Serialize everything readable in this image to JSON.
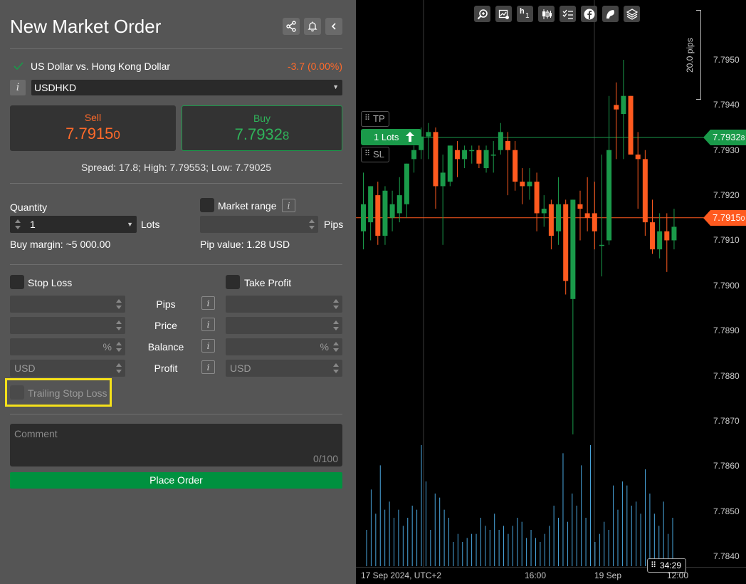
{
  "order": {
    "title": "New Market Order",
    "instrument_name": "US Dollar vs. Hong Kong Dollar",
    "change": "-3.7 (0.00%)",
    "symbol": "USDHKD",
    "sell_label": "Sell",
    "sell_price_main": "7.7915",
    "sell_price_pip": "0",
    "buy_label": "Buy",
    "buy_price_main": "7.7932",
    "buy_price_pip": "8",
    "stats": "Spread: 17.8; High: 7.79553; Low: 7.79025",
    "quantity_label": "Quantity",
    "quantity_value": "1",
    "quantity_unit": "Lots",
    "market_range_label": "Market range",
    "pips_unit": "Pips",
    "buy_margin": "Buy margin: ~5 000.00",
    "pip_value": "Pip value: 1.28 USD",
    "stop_loss_label": "Stop Loss",
    "take_profit_label": "Take Profit",
    "row_labels": [
      "Pips",
      "Price",
      "Balance",
      "Profit"
    ],
    "percent_suffix": "%",
    "currency_placeholder": "USD",
    "trailing_stop_label": "Trailing Stop Loss",
    "comment_placeholder": "Comment",
    "comment_count": "0/100",
    "place_order_label": "Place Order",
    "info_glyph": "i"
  },
  "chart": {
    "colors": {
      "bull": "#1a9a4a",
      "bear": "#ff5a1f",
      "volume": "#4aa8e0",
      "buy_line": "#1a9a4a",
      "sell_line": "#ff5a1f"
    },
    "toolbar_icons": [
      "zoom-icon",
      "settings-chart-icon",
      "timeframe-h1-icon",
      "candles-icon",
      "indicators-icon",
      "facebook-icon",
      "drawings-icon",
      "layers-icon"
    ],
    "timeframe_label": "h",
    "timeframe_sub": "1",
    "price_labels": [
      "7.7950",
      "7.7940",
      "7.7930",
      "7.7920",
      "7.7910",
      "7.7900",
      "7.7890",
      "7.7880",
      "7.7870",
      "7.7860",
      "7.7850",
      "7.7840"
    ],
    "buy_tag_main": "7.7932",
    "buy_tag_pip": "8",
    "sell_tag_main": "7.7915",
    "sell_tag_pip": "0",
    "pips_scale_label": "20.0 pips",
    "tp_label": "TP",
    "sl_label": "SL",
    "lots_label": "1 Lots",
    "time_labels": [
      "17 Sep 2024, UTC+2",
      "16:00",
      "19 Sep",
      "12:00"
    ],
    "countdown": "34:29"
  },
  "chart_data": {
    "type": "candlestick",
    "symbol": "USDHKD",
    "ylim": [
      7.7837,
      7.7962
    ],
    "bid": 7.7915,
    "ask": 7.79328,
    "candles": [
      {
        "o": 7.7912,
        "h": 7.7925,
        "l": 7.7908,
        "c": 7.7918
      },
      {
        "o": 7.7914,
        "h": 7.7922,
        "l": 7.791,
        "c": 7.7922
      },
      {
        "o": 7.792,
        "h": 7.7923,
        "l": 7.7909,
        "c": 7.7911
      },
      {
        "o": 7.7911,
        "h": 7.7922,
        "l": 7.7909,
        "c": 7.7921
      },
      {
        "o": 7.7915,
        "h": 7.7921,
        "l": 7.7912,
        "c": 7.7918
      },
      {
        "o": 7.7916,
        "h": 7.7924,
        "l": 7.7914,
        "c": 7.792
      },
      {
        "o": 7.7918,
        "h": 7.7927,
        "l": 7.7915,
        "c": 7.7927
      },
      {
        "o": 7.7928,
        "h": 7.7931,
        "l": 7.7925,
        "c": 7.793
      },
      {
        "o": 7.793,
        "h": 7.7935,
        "l": 7.7928,
        "c": 7.7933
      },
      {
        "o": 7.7933,
        "h": 7.7936,
        "l": 7.7928,
        "c": 7.7934
      },
      {
        "o": 7.7934,
        "h": 7.7935,
        "l": 7.7917,
        "c": 7.7922
      },
      {
        "o": 7.7922,
        "h": 7.7929,
        "l": 7.7909,
        "c": 7.7925
      },
      {
        "o": 7.7923,
        "h": 7.7931,
        "l": 7.7922,
        "c": 7.7931
      },
      {
        "o": 7.793,
        "h": 7.7932,
        "l": 7.7924,
        "c": 7.7928
      },
      {
        "o": 7.7928,
        "h": 7.7931,
        "l": 7.7926,
        "c": 7.793
      },
      {
        "o": 7.793,
        "h": 7.7931,
        "l": 7.7927,
        "c": 7.793
      },
      {
        "o": 7.793,
        "h": 7.7931,
        "l": 7.7926,
        "c": 7.7927
      },
      {
        "o": 7.7926,
        "h": 7.7931,
        "l": 7.7925,
        "c": 7.793
      },
      {
        "o": 7.7929,
        "h": 7.7932,
        "l": 7.7925,
        "c": 7.7929
      },
      {
        "o": 7.793,
        "h": 7.7936,
        "l": 7.7929,
        "c": 7.7934
      },
      {
        "o": 7.7932,
        "h": 7.7934,
        "l": 7.792,
        "c": 7.793
      },
      {
        "o": 7.793,
        "h": 7.7932,
        "l": 7.7921,
        "c": 7.7923
      },
      {
        "o": 7.7923,
        "h": 7.7926,
        "l": 7.7918,
        "c": 7.7922
      },
      {
        "o": 7.7922,
        "h": 7.7926,
        "l": 7.7919,
        "c": 7.7923
      },
      {
        "o": 7.7923,
        "h": 7.7925,
        "l": 7.7912,
        "c": 7.7916
      },
      {
        "o": 7.7916,
        "h": 7.792,
        "l": 7.7913,
        "c": 7.7917
      },
      {
        "o": 7.7918,
        "h": 7.7919,
        "l": 7.7908,
        "c": 7.7911
      },
      {
        "o": 7.7912,
        "h": 7.7924,
        "l": 7.7909,
        "c": 7.7918
      },
      {
        "o": 7.7918,
        "h": 7.7919,
        "l": 7.7898,
        "c": 7.7901
      },
      {
        "o": 7.7897,
        "h": 7.7919,
        "l": 7.7867,
        "c": 7.7919
      },
      {
        "o": 7.7918,
        "h": 7.7921,
        "l": 7.791,
        "c": 7.7917
      },
      {
        "o": 7.7916,
        "h": 7.7924,
        "l": 7.7912,
        "c": 7.7915
      },
      {
        "o": 7.7916,
        "h": 7.7923,
        "l": 7.7908,
        "c": 7.7912
      },
      {
        "o": 7.7909,
        "h": 7.7929,
        "l": 7.7902,
        "c": 7.7909
      },
      {
        "o": 7.791,
        "h": 7.7942,
        "l": 7.7909,
        "c": 7.793
      },
      {
        "o": 7.794,
        "h": 7.7945,
        "l": 7.7928,
        "c": 7.7939
      },
      {
        "o": 7.7938,
        "h": 7.795,
        "l": 7.7928,
        "c": 7.7942
      },
      {
        "o": 7.7942,
        "h": 7.7942,
        "l": 7.7929,
        "c": 7.7929
      },
      {
        "o": 7.7929,
        "h": 7.7934,
        "l": 7.7917,
        "c": 7.7928
      },
      {
        "o": 7.7928,
        "h": 7.793,
        "l": 7.7911,
        "c": 7.7914
      },
      {
        "o": 7.7914,
        "h": 7.7919,
        "l": 7.7907,
        "c": 7.7908
      },
      {
        "o": 7.7908,
        "h": 7.7916,
        "l": 7.7906,
        "c": 7.7912
      },
      {
        "o": 7.7912,
        "h": 7.7916,
        "l": 7.7903,
        "c": 7.791
      },
      {
        "o": 7.791,
        "h": 7.7917,
        "l": 7.7908,
        "c": 7.7913
      }
    ],
    "volume": [
      9,
      19,
      13,
      25,
      14,
      16,
      12,
      14,
      10,
      12,
      15,
      14,
      30,
      21,
      9,
      18,
      17,
      14,
      12,
      6,
      8,
      6,
      7,
      8,
      8,
      12,
      10,
      9,
      13,
      9,
      10,
      8,
      10,
      12,
      11,
      7,
      9,
      7,
      6,
      8,
      10,
      15,
      12,
      28,
      11,
      18,
      15,
      25,
      12,
      30,
      6,
      8,
      11,
      9,
      20,
      14,
      21,
      20,
      15,
      16,
      13,
      24,
      18,
      13,
      10,
      16,
      8,
      12
    ],
    "xlabels": [
      "17 Sep 2024, UTC+2",
      "16:00",
      "19 Sep",
      "12:00"
    ]
  }
}
